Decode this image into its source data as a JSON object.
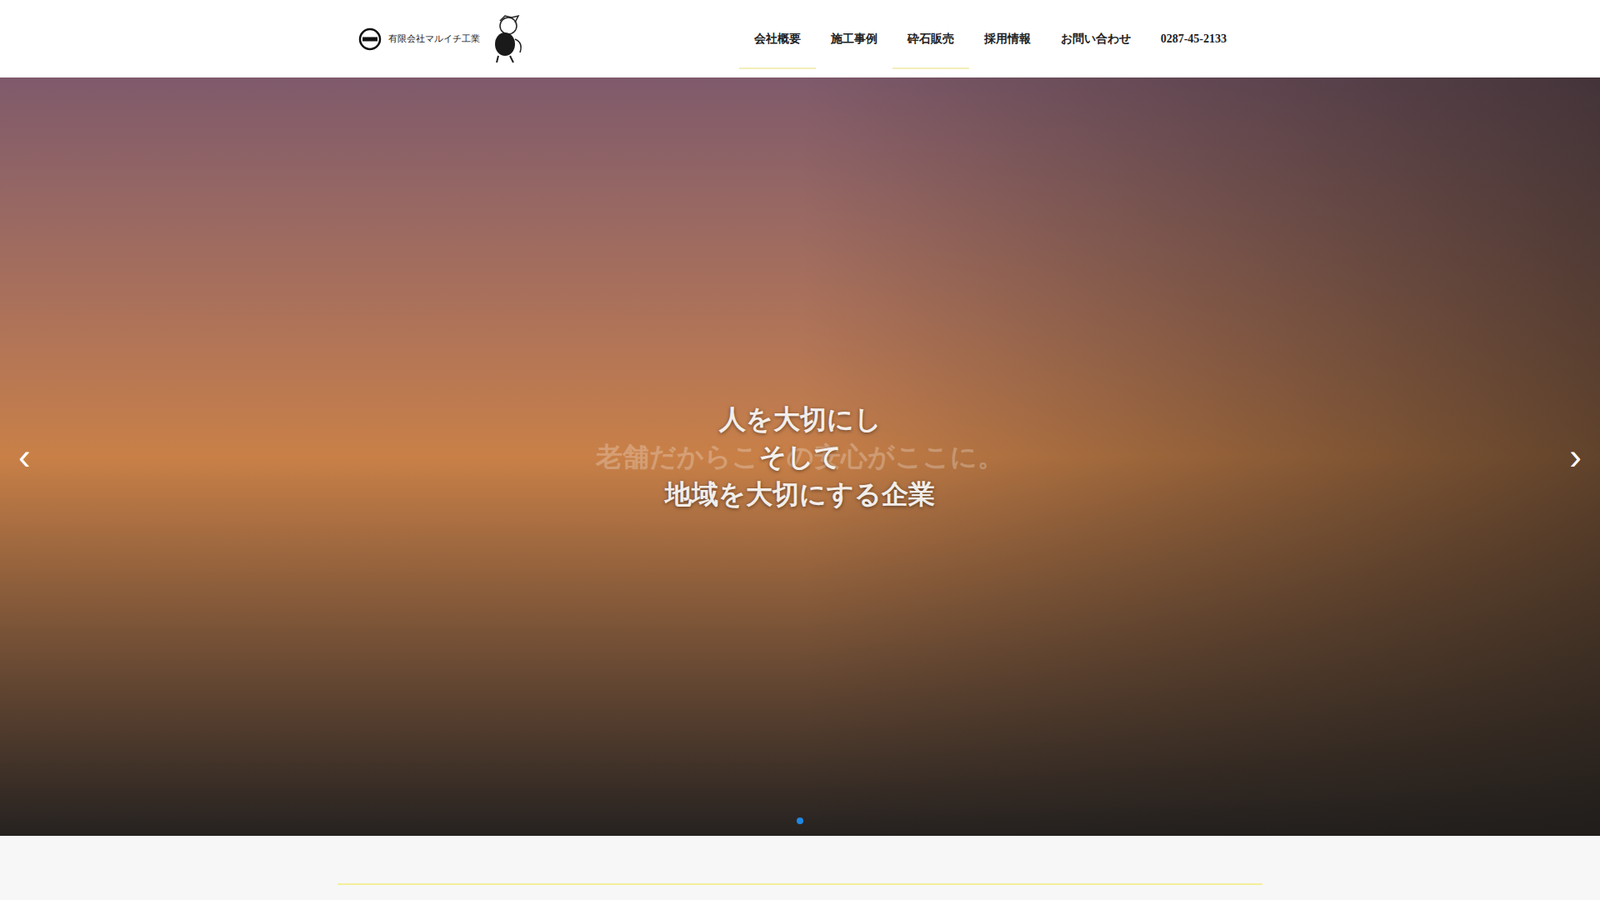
{
  "header": {
    "logo_text": "有限会社マルイチ工業"
  },
  "nav": [
    {
      "label": "会社概要",
      "underlined": true
    },
    {
      "label": "施工事例",
      "underlined": false
    },
    {
      "label": "砕石販売",
      "underlined": true
    },
    {
      "label": "採用情報",
      "underlined": false
    },
    {
      "label": "お問い合わせ",
      "underlined": false
    },
    {
      "label": "0287-45-2133",
      "underlined": false
    }
  ],
  "hero": {
    "lines": [
      "人を大切にし",
      "そして",
      "地域を大切にする企業"
    ],
    "fading_caption": "老舗だからこその安心がここに。",
    "prev": "‹",
    "next": "›",
    "dots": [
      {
        "selected": true
      }
    ]
  }
}
